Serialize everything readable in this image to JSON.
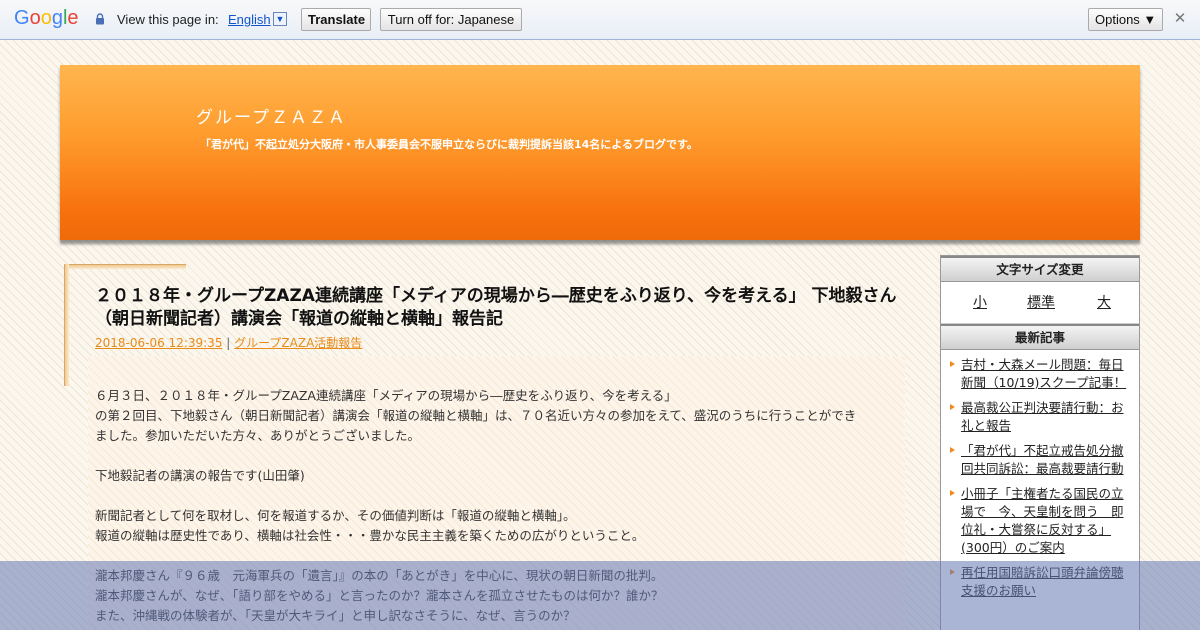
{
  "translate_bar": {
    "logo": "Google",
    "prompt": "View this page in:",
    "language": "English",
    "translate_label": "Translate",
    "turn_off_label": "Turn off for: Japanese",
    "options_label": "Options ▼",
    "close_glyph": "✕"
  },
  "header": {
    "title": "グループＺＡＺＡ",
    "description": "「君が代」不起立処分大阪府・市人事委員会不服申立ならびに裁判提訴当該14名によるブログです。"
  },
  "post": {
    "title": "２０１８年・グループZAZA連続講座「メディアの現場から―歴史をふり返り、今を考える」 下地毅さん（朝日新聞記者）講演会「報道の縦軸と横軸」報告記",
    "date": "2018-06-06 12:39:35",
    "separator": "|",
    "category": "グループZAZA活動報告",
    "paragraphs": [
      [
        "６月３日、２０１８年・グループZAZA連続講座「メディアの現場から―歴史をふり返り、今を考える」",
        "の第２回目、下地毅さん（朝日新聞記者）講演会「報道の縦軸と横軸」は、７０名近い方々の参加をえて、盛況のうちに行うことができ",
        "ました。参加いただいた方々、ありがとうございました。"
      ],
      [
        "下地毅記者の講演の報告です(山田肇)"
      ],
      [
        "新聞記者として何を取材し、何を報道するか、その価値判断は「報道の縦軸と横軸」。",
        "報道の縦軸は歴史性であり、横軸は社会性・・・豊かな民主主義を築くための広がりということ。"
      ],
      [
        "瀧本邦慶さん『９６歳　元海軍兵の「遺言」』の本の「あとがき」を中心に、現状の朝日新聞の批判。",
        "瀧本邦慶さんが、なぜ、「語り部をやめる」と言ったのか？瀧本さんを孤立させたものは何か？誰か？",
        "また、沖縄戦の体験者が、「天皇が大キライ」と申し訳なさそうに、なぜ、言うのか？"
      ]
    ]
  },
  "sidebar": {
    "font_size_heading": "文字サイズ変更",
    "font_sizes": [
      "小",
      "標準",
      "大"
    ],
    "recent_heading": "最新記事",
    "recent_posts": [
      [
        "吉村・大森メール問題：毎日",
        "新聞（10/19)スクープ記事！"
      ],
      [
        "最高裁公正判決要請行動：お",
        "礼と報告"
      ],
      [
        "「君が代」不起立戒告処分撤",
        "回共同訴訟：最高裁要請行動"
      ],
      [
        "小冊子「主権者たる国民の立",
        "場で　今、天皇制を問う　即",
        "位礼・大嘗祭に反対する」",
        "(300円）のご案内"
      ],
      [
        "再任用国賠訴訟口頭弁論傍聴",
        "支援のお願い"
      ]
    ]
  },
  "colors": {
    "header_top": "#ffb54e",
    "header_bottom": "#ef6a0a",
    "link_orange": "#e98b1a",
    "google_link": "#1155cc"
  }
}
